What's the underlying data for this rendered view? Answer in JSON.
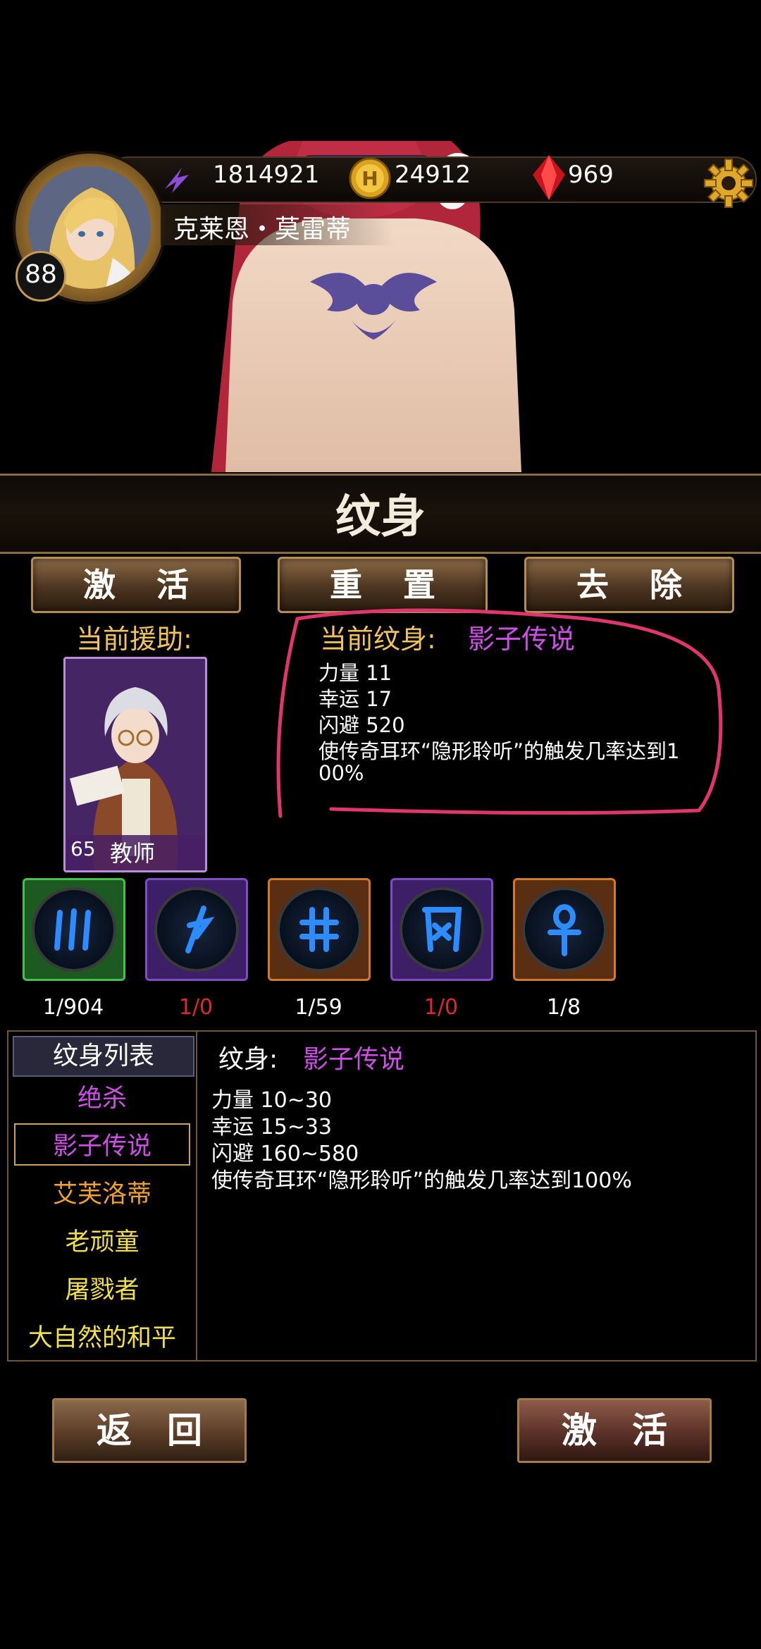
{
  "player": {
    "level": "88",
    "name": "克莱恩・莫雷蒂",
    "power": "1814921",
    "gold": "24912",
    "gems": "969"
  },
  "page": {
    "title": "纹身"
  },
  "actions": {
    "activate": "激活",
    "reset": "重置",
    "remove": "去除"
  },
  "helper": {
    "label": "当前援助:",
    "level": "65",
    "class": "教师"
  },
  "current_tattoo": {
    "label": "当前纹身:",
    "name": "影子传说",
    "stats": [
      "力量 11",
      "幸运 17",
      "闪避 520",
      "使传奇耳环“隐形聆听”的触发几率达到1",
      "00%"
    ]
  },
  "runes": [
    {
      "count": "1/904",
      "frame": "green",
      "count_color": "#ffffff"
    },
    {
      "count": "1/0",
      "frame": "purple",
      "count_color": "#e02828"
    },
    {
      "count": "1/59",
      "frame": "orange",
      "count_color": "#ffffff"
    },
    {
      "count": "1/0",
      "frame": "purple",
      "count_color": "#e02828"
    },
    {
      "count": "1/8",
      "frame": "orange",
      "count_color": "#ffffff"
    }
  ],
  "tattoo_list": {
    "header": "纹身列表",
    "items": [
      "绝杀",
      "影子传说",
      "艾芙洛蒂",
      "老顽童",
      "屠戮者",
      "大自然的和平"
    ],
    "selected": "影子传说"
  },
  "detail": {
    "label": "纹身:",
    "name": "影子传说",
    "lines": [
      "力量 10~30",
      "幸运 15~33",
      "闪避 160~580",
      "使传奇耳环“隐形聆听”的触发几率达到100%"
    ]
  },
  "footer": {
    "back": "返回",
    "activate": "激活"
  },
  "colors": {
    "accent_gold": "#f2c25d",
    "tattoo_purple": "#cf4fe6",
    "list_orange": "#f0a030",
    "list_yellow": "#f1e04a"
  }
}
